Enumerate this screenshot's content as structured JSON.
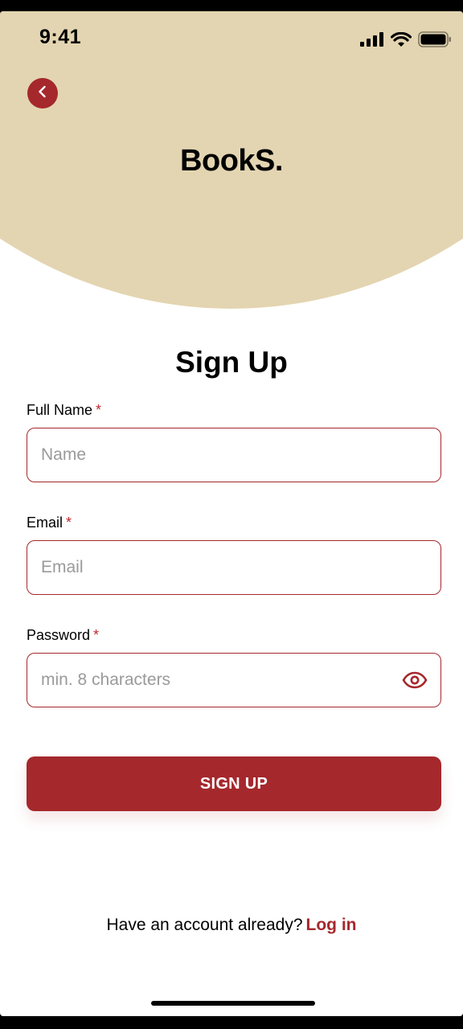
{
  "status_bar": {
    "time": "9:41",
    "icons": [
      "signal-icon",
      "wifi-icon",
      "battery-icon"
    ]
  },
  "header": {
    "back_icon": "chevron-left-icon",
    "brand": "BookS."
  },
  "form": {
    "title": "Sign Up",
    "required_mark": "*",
    "full_name": {
      "label": "Full Name",
      "placeholder": "Name",
      "value": ""
    },
    "email": {
      "label": "Email",
      "placeholder": "Email",
      "value": ""
    },
    "password": {
      "label": "Password",
      "placeholder": "min. 8 characters",
      "value": "",
      "toggle_icon": "eye-icon"
    },
    "submit_label": "SIGN UP"
  },
  "footer": {
    "prompt": "Have an account already?",
    "link": "Log in"
  },
  "colors": {
    "accent": "#a5282c",
    "header_bg": "#e3d5b1",
    "required": "#c0282e",
    "placeholder": "#9a9a9a"
  }
}
